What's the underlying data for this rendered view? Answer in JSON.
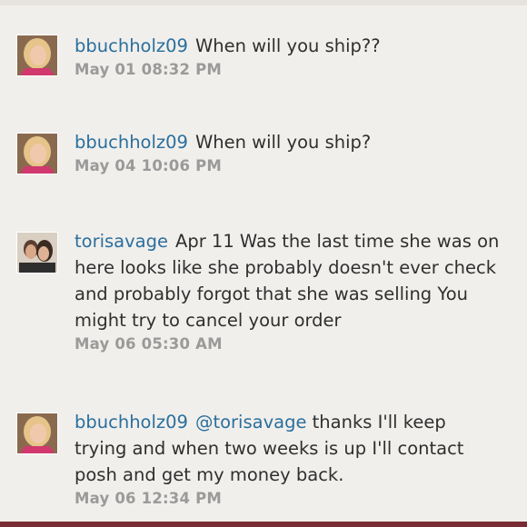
{
  "comments": [
    {
      "username": "bbuchholz09",
      "message": "When will you ship??",
      "timestamp": "May 01 08:32 PM",
      "avatar_icon": "user-avatar-blonde"
    },
    {
      "username": "bbuchholz09",
      "message": "When will you ship?",
      "timestamp": "May 04 10:06 PM",
      "avatar_icon": "user-avatar-blonde"
    },
    {
      "username": "torisavage",
      "message": "Apr 11 Was the last time she was on here looks like she probably doesn't ever check and probably forgot that she was selling You might try to cancel your order",
      "timestamp": "May 06 05:30 AM",
      "avatar_icon": "user-avatar-couple"
    },
    {
      "username": "bbuchholz09",
      "mention": "@torisavage",
      "message": "thanks I'll keep trying and when two weeks is up I'll contact posh and get my money back.",
      "timestamp": "May 06 12:34 PM",
      "avatar_icon": "user-avatar-blonde"
    }
  ],
  "colors": {
    "background": "#f1efec",
    "username": "#2a6f9d",
    "timestamp": "#9a9a9a",
    "footer_bar": "#7a2c34"
  }
}
